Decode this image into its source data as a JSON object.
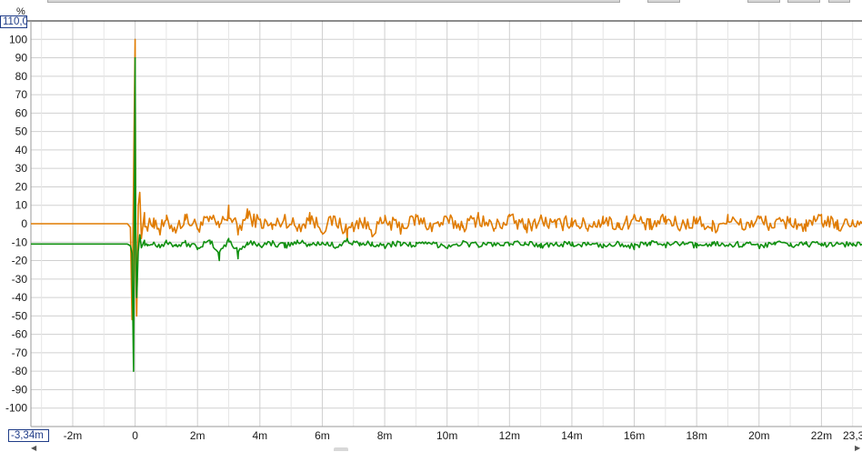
{
  "y_unit": "%",
  "y_max_box": "110,0",
  "x_min_box": "-3,34m",
  "y_tick_labels": [
    "100",
    "90",
    "80",
    "70",
    "60",
    "50",
    "40",
    "30",
    "20",
    "10",
    "0",
    "-10",
    "-20",
    "-30",
    "-40",
    "-50",
    "-60",
    "-70",
    "-80",
    "-90",
    "-100"
  ],
  "x_tick_labels": [
    "-2m",
    "0",
    "2m",
    "4m",
    "6m",
    "8m",
    "10m",
    "12m",
    "14m",
    "16m",
    "18m",
    "20m",
    "22m",
    "23,3"
  ],
  "chart_data": {
    "type": "line",
    "xlabel": "",
    "ylabel": "%",
    "x_unit": "ms",
    "xlim": [
      -3.34,
      23.3
    ],
    "ylim": [
      -110,
      110
    ],
    "y_ticks": [
      100,
      90,
      80,
      70,
      60,
      50,
      40,
      30,
      20,
      10,
      0,
      -10,
      -20,
      -30,
      -40,
      -50,
      -60,
      -70,
      -80,
      -90,
      -100
    ],
    "x_ticks": [
      -2,
      0,
      2,
      4,
      6,
      8,
      10,
      12,
      14,
      16,
      18,
      20,
      22
    ],
    "grid": true,
    "legend": "none",
    "series": [
      {
        "color": "#e07b00",
        "baseline": 0,
        "x": [
          -3.34,
          -0.5,
          -0.25,
          -0.15,
          -0.1,
          -0.05,
          0.0,
          0.02,
          0.05,
          0.1,
          0.15,
          0.2,
          0.3,
          0.4,
          0.6,
          0.8,
          1.0,
          1.3,
          1.6,
          2.0,
          2.4,
          2.7,
          3.0,
          3.3,
          3.6,
          4.0,
          4.4,
          4.8,
          5.2,
          5.6,
          6.0,
          6.4,
          6.8,
          7.2,
          7.6,
          8.0,
          8.5,
          9.0,
          9.5,
          10.0,
          10.5,
          11.0,
          11.5,
          12.0,
          12.5,
          13.0,
          13.5,
          14.0,
          14.5,
          15.0,
          15.5,
          16.0,
          16.5,
          17.0,
          17.5,
          18.0,
          18.5,
          19.0,
          19.5,
          20.0,
          20.5,
          21.0,
          21.5,
          22.0,
          22.5,
          23.0,
          23.3
        ],
        "y": [
          0,
          0,
          0,
          -2,
          -52,
          23,
          100,
          -25,
          -50,
          10,
          17,
          -8,
          6,
          -4,
          3,
          -6,
          2,
          -5,
          5,
          -3,
          4,
          -2,
          10,
          -6,
          8,
          2,
          -3,
          5,
          -4,
          6,
          -5,
          4,
          -8,
          3,
          -7,
          2,
          -4,
          5,
          -3,
          3,
          -2,
          6,
          -4,
          5,
          -3,
          4,
          -2,
          3,
          -3,
          4,
          -2,
          5,
          -3,
          4,
          -2,
          3,
          -4,
          5,
          -3,
          4,
          -2,
          3,
          -4,
          5,
          -3,
          2,
          0
        ]
      },
      {
        "color": "#109010",
        "baseline": -11,
        "x": [
          -3.34,
          -0.5,
          -0.25,
          -0.15,
          -0.1,
          -0.05,
          0.0,
          0.02,
          0.05,
          0.1,
          0.15,
          0.2,
          0.3,
          0.4,
          0.6,
          0.8,
          1.0,
          1.3,
          1.6,
          2.0,
          2.4,
          2.7,
          3.0,
          3.3,
          3.6,
          4.0,
          4.4,
          4.8,
          5.2,
          5.6,
          6.0,
          6.4,
          6.8,
          7.2,
          7.6,
          8.0,
          8.5,
          9.0,
          9.5,
          10.0,
          10.5,
          11.0,
          11.5,
          12.0,
          12.5,
          13.0,
          13.5,
          14.0,
          14.5,
          15.0,
          15.5,
          16.0,
          16.5,
          17.0,
          17.5,
          18.0,
          18.5,
          19.0,
          19.5,
          20.0,
          20.5,
          21.0,
          21.5,
          22.0,
          22.5,
          23.0,
          23.3
        ],
        "y": [
          -11,
          -11,
          -11,
          -12,
          -16,
          -80,
          90,
          -5,
          -40,
          -15,
          -6,
          -13,
          -9,
          -12,
          -10,
          -13,
          -9,
          -12,
          -10,
          -14,
          -9,
          -20,
          -8,
          -19,
          -10,
          -12,
          -10,
          -13,
          -9,
          -12,
          -10,
          -13,
          -8,
          -12,
          -10,
          -13,
          -10,
          -12,
          -11,
          -13,
          -10,
          -12,
          -11,
          -12,
          -10,
          -13,
          -10,
          -12,
          -11,
          -13,
          -10,
          -14,
          -10,
          -12,
          -11,
          -13,
          -10,
          -12,
          -11,
          -13,
          -10,
          -12,
          -11,
          -12,
          -10,
          -12,
          -11
        ]
      }
    ]
  }
}
